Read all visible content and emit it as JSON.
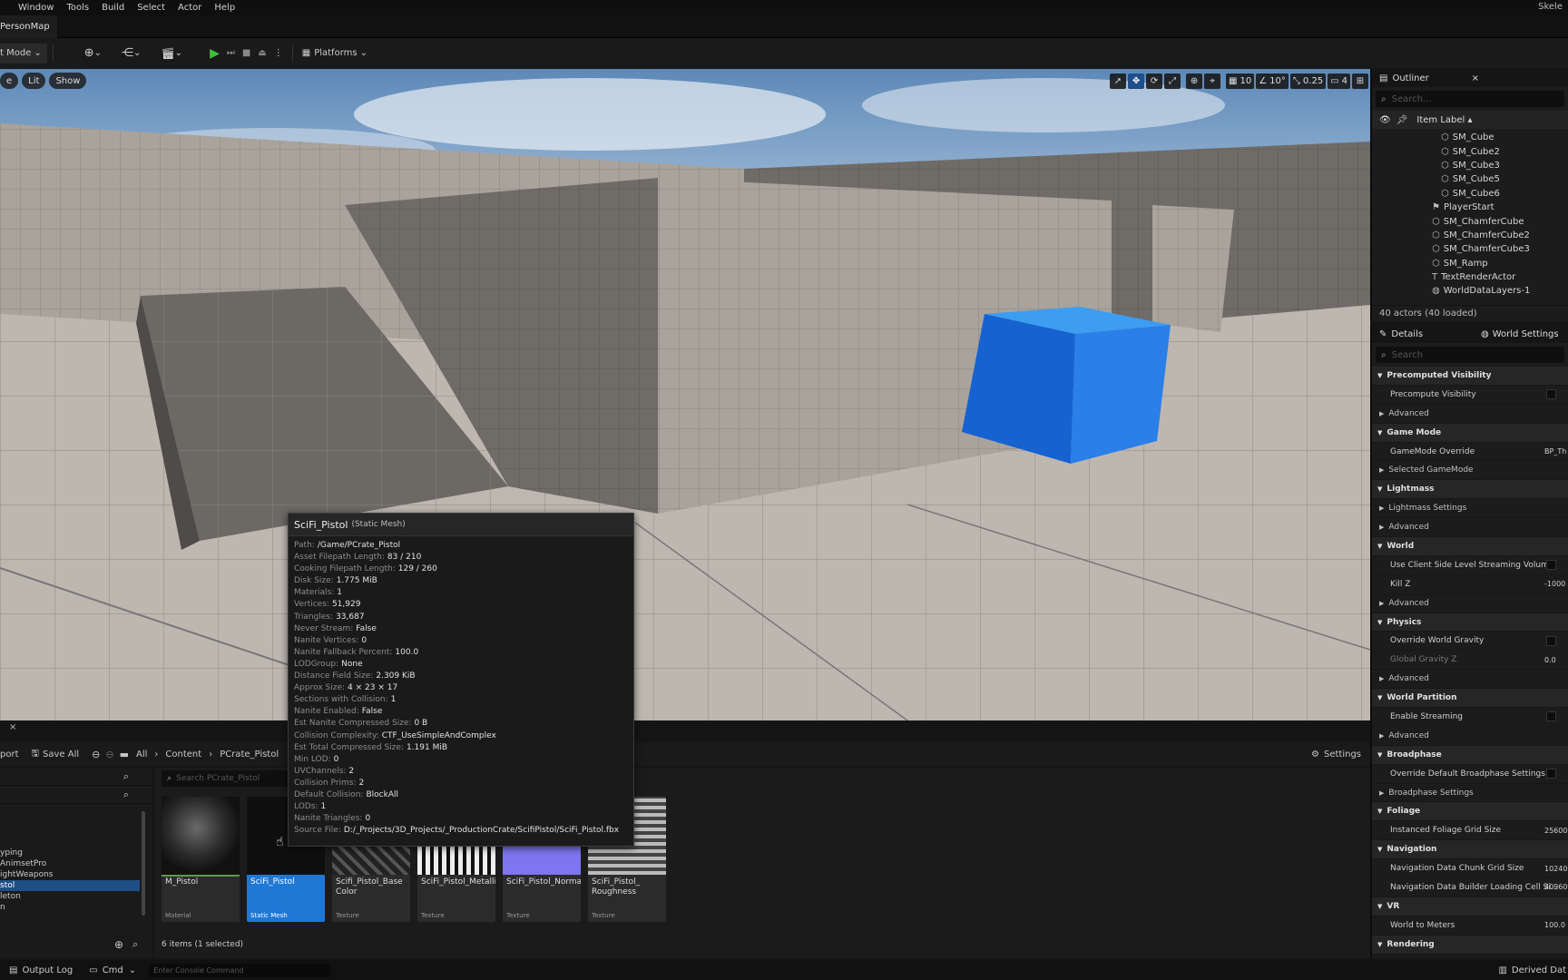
{
  "menu": [
    "Window",
    "Tools",
    "Build",
    "Select",
    "Actor",
    "Help"
  ],
  "project_name": "Skele",
  "map_tab": "PersonMap",
  "toolbar": {
    "mode": "t Mode",
    "platforms": "Platforms"
  },
  "viewport": {
    "left_buttons": [
      "e",
      "Lit",
      "Show"
    ],
    "grid_snap": "10",
    "rot_snap": "10°",
    "scale_snap": "0.25",
    "camera_speed": "4"
  },
  "outliner": {
    "title": "Outliner",
    "search_placeholder": "Search...",
    "column": "Item Label ▴",
    "items": [
      "SM_Cube",
      "SM_Cube2",
      "SM_Cube3",
      "SM_Cube5",
      "SM_Cube6",
      "PlayerStart",
      "SM_ChamferCube",
      "SM_ChamferCube2",
      "SM_ChamferCube3",
      "SM_Ramp",
      "TextRenderActor",
      "WorldDataLayers-1"
    ],
    "footer": "40 actors (40 loaded)"
  },
  "details": {
    "tab1": "Details",
    "tab2": "World Settings",
    "search_placeholder": "Search",
    "rows": [
      {
        "kind": "cat",
        "label": "Precomputed Visibility"
      },
      {
        "kind": "prop",
        "label": "Precompute Visibility",
        "check": true
      },
      {
        "kind": "sub",
        "label": "Advanced"
      },
      {
        "kind": "cat",
        "label": "Game Mode"
      },
      {
        "kind": "prop",
        "label": "GameMode Override",
        "value": "BP_Th"
      },
      {
        "kind": "sub",
        "label": "Selected GameMode"
      },
      {
        "kind": "cat",
        "label": "Lightmass"
      },
      {
        "kind": "sub",
        "label": "Lightmass Settings"
      },
      {
        "kind": "sub",
        "label": "Advanced"
      },
      {
        "kind": "cat",
        "label": "World"
      },
      {
        "kind": "prop",
        "label": "Use Client Side Level Streaming Volum...",
        "check": true
      },
      {
        "kind": "prop",
        "label": "Kill Z",
        "value": "-1000"
      },
      {
        "kind": "sub",
        "label": "Advanced"
      },
      {
        "kind": "cat",
        "label": "Physics"
      },
      {
        "kind": "prop",
        "label": "Override World Gravity",
        "check": true
      },
      {
        "kind": "prop",
        "label": "Global Gravity Z",
        "value": "0.0",
        "disabled": true
      },
      {
        "kind": "sub",
        "label": "Advanced"
      },
      {
        "kind": "cat",
        "label": "World Partition"
      },
      {
        "kind": "prop",
        "label": "Enable Streaming",
        "check": true
      },
      {
        "kind": "sub",
        "label": "Advanced"
      },
      {
        "kind": "cat",
        "label": "Broadphase"
      },
      {
        "kind": "prop",
        "label": "Override Default Broadphase Settings",
        "check": true
      },
      {
        "kind": "sub",
        "label": "Broadphase Settings"
      },
      {
        "kind": "cat",
        "label": "Foliage"
      },
      {
        "kind": "prop",
        "label": "Instanced Foliage Grid Size",
        "value": "25600"
      },
      {
        "kind": "cat",
        "label": "Navigation"
      },
      {
        "kind": "prop",
        "label": "Navigation Data Chunk Grid Size",
        "value": "10240"
      },
      {
        "kind": "prop",
        "label": "Navigation Data Builder Loading Cell Si...",
        "value": "40960"
      },
      {
        "kind": "cat",
        "label": "VR"
      },
      {
        "kind": "prop",
        "label": "World to Meters",
        "value": "100.0"
      },
      {
        "kind": "cat",
        "label": "Rendering"
      }
    ]
  },
  "content_browser": {
    "import": "port",
    "save_all": "Save All",
    "breadcrumb": [
      "All",
      "Content",
      "PCrate_Pistol"
    ],
    "settings": "Settings",
    "search_placeholder": "Search PCrate_Pistol",
    "folders": [
      "yping",
      "AnimsetPro",
      "ightWeapons",
      "stol",
      "leton",
      "n"
    ],
    "assets": [
      {
        "name": "M_Pistol",
        "type": "Material"
      },
      {
        "name": "SciFi_Pistol",
        "type": "Static Mesh"
      },
      {
        "name": "Scifi_Pistol_Base Color",
        "type": "Texture"
      },
      {
        "name": "SciFi_Pistol_Metallic",
        "type": "Texture"
      },
      {
        "name": "SciFi_Pistol_Normal",
        "type": "Texture"
      },
      {
        "name": "SciFi_Pistol_ Roughness",
        "type": "Texture"
      }
    ],
    "status": "6 items (1 selected)"
  },
  "tooltip": {
    "title": "SciFi_Pistol",
    "subtitle": "(Static Mesh)",
    "rows": [
      {
        "k": "Path:",
        "v": "/Game/PCrate_Pistol"
      },
      {
        "k": "Asset Filepath Length:",
        "v": "83 / 210"
      },
      {
        "k": "Cooking Filepath Length:",
        "v": "129 / 260"
      },
      {
        "k": "Disk Size:",
        "v": "1.775 MiB"
      },
      {
        "k": "Materials:",
        "v": "1"
      },
      {
        "k": "Vertices:",
        "v": "51,929"
      },
      {
        "k": "Triangles:",
        "v": "33,687"
      },
      {
        "k": "Never Stream:",
        "v": "False"
      },
      {
        "k": "Nanite Vertices:",
        "v": "0"
      },
      {
        "k": "Nanite Fallback Percent:",
        "v": "100.0"
      },
      {
        "k": "LODGroup:",
        "v": "None"
      },
      {
        "k": "Distance Field Size:",
        "v": "2.309 KiB"
      },
      {
        "k": "Approx Size:",
        "v": "4 × 23 × 17"
      },
      {
        "k": "Sections with Collision:",
        "v": "1"
      },
      {
        "k": "Nanite Enabled:",
        "v": "False"
      },
      {
        "k": "Est Nanite Compressed Size:",
        "v": "0 B"
      },
      {
        "k": "Collision Complexity:",
        "v": "CTF_UseSimpleAndComplex"
      },
      {
        "k": "Est Total Compressed Size:",
        "v": "1.191 MiB"
      },
      {
        "k": "Min LOD:",
        "v": "0"
      },
      {
        "k": "UVChannels:",
        "v": "2"
      },
      {
        "k": "Collision Prims:",
        "v": "2"
      },
      {
        "k": "Default Collision:",
        "v": "BlockAll"
      },
      {
        "k": "LODs:",
        "v": "1"
      },
      {
        "k": "Nanite Triangles:",
        "v": "0"
      },
      {
        "k": "Source File:",
        "v": "D:/_Projects/3D_Projects/_ProductionCrate/ScifiPistol/SciFi_Pistol.fbx"
      }
    ]
  },
  "statusbar": {
    "output_log": "Output Log",
    "cmd": "Cmd",
    "console_placeholder": "Enter Console Command",
    "derived": "Derived Dat"
  }
}
